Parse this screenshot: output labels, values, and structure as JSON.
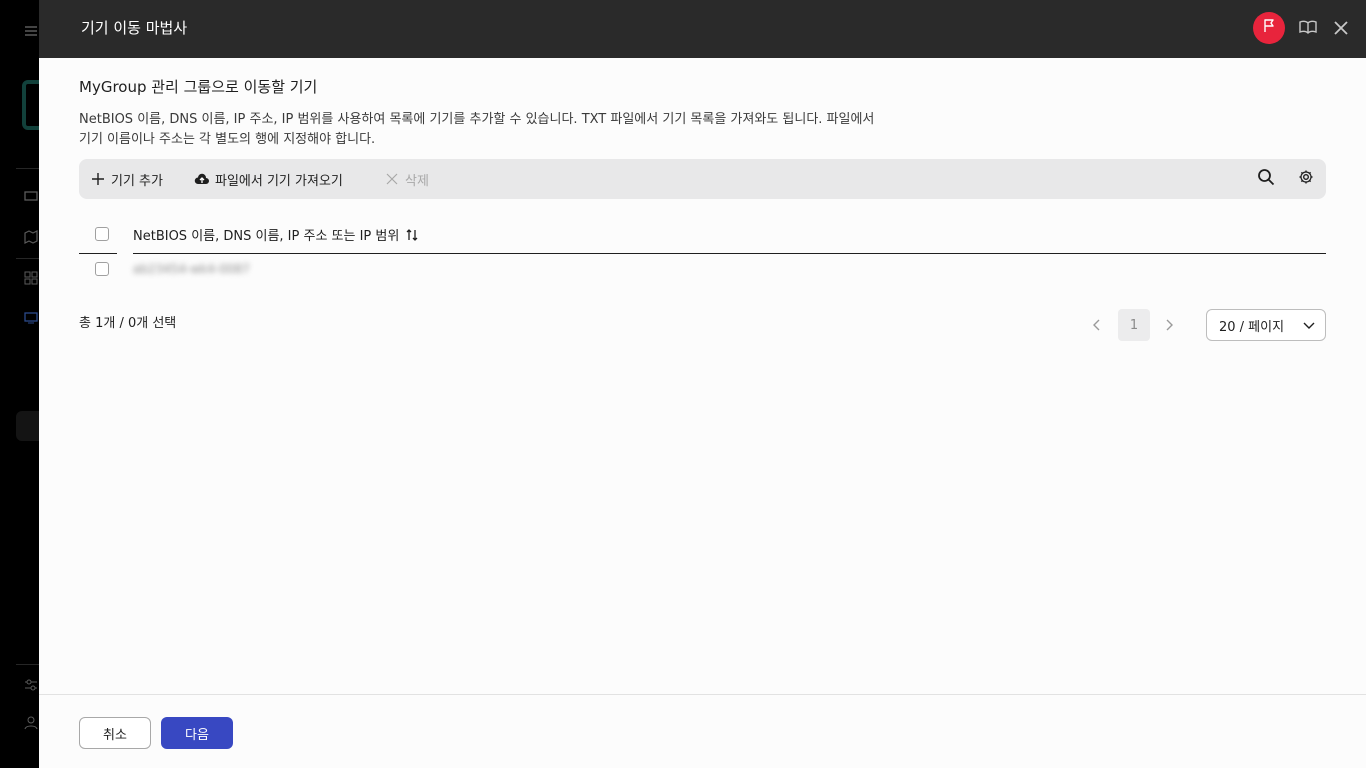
{
  "wizard": {
    "title": "기기 이동 마법사",
    "subtitle": "MyGroup 관리 그룹으로 이동할 기기",
    "description_line1": "NetBIOS 이름, DNS 이름, IP 주소, IP 범위를 사용하여 목록에 기기를 추가할 수 있습니다. TXT 파일에서 기기 목록을 가져와도 됩니다. 파일에서",
    "description_line2": "기기 이름이나 주소는 각 별도의 행에 지정해야 합니다."
  },
  "header_icons": [
    "flag-icon",
    "book-icon",
    "close-icon"
  ],
  "toolbar": {
    "add_label": "기기 추가",
    "import_label": "파일에서 기기 가져오기",
    "delete_label": "삭제"
  },
  "table": {
    "column_header": "NetBIOS 이름, DNS 이름, IP 주소 또는 IP 범위",
    "rows": [
      {
        "name": "ab23454-wk4-0087"
      }
    ]
  },
  "footer": {
    "count_text": "총 1개 / 0개 선택",
    "current_page": "1",
    "page_size": "20 / 페이지"
  },
  "buttons": {
    "cancel": "취소",
    "next": "다음"
  },
  "colors": {
    "header_bg": "#2a2a2a",
    "flag_badge": "#e8243c",
    "primary": "#3848c2"
  }
}
